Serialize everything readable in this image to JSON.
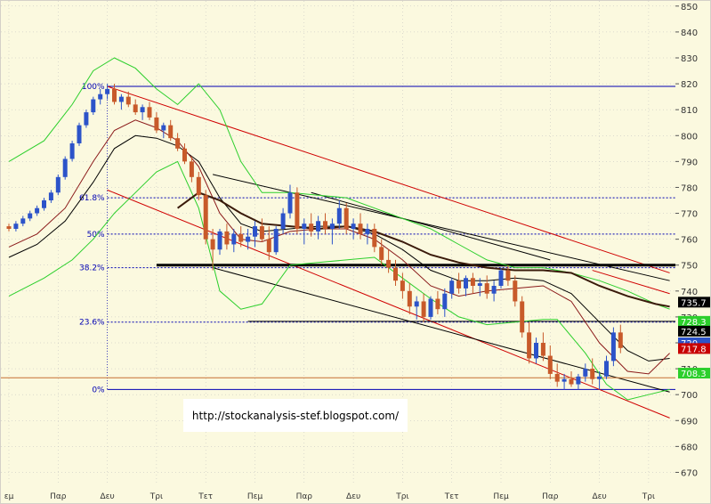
{
  "watermark": "http://stockanalysis-stef.blogspot.com/",
  "colors": {
    "background": "#fbf9df",
    "axis_bg": "#fbf9df",
    "grid": "#bdbdbd",
    "fib": "#0000b3",
    "up_candle": "#2c53c9",
    "down_candle": "#c85a2a",
    "bollinger": "#2ccf2c",
    "ma_fast": "#8b1a1a",
    "ma_slow": "#000000",
    "channel_red": "#d00000",
    "channel_black": "#000000",
    "support_orange": "#c87033"
  },
  "chart_data": {
    "type": "candlestick",
    "y_axis": {
      "min": 665,
      "max": 852,
      "ticks": [
        670,
        680,
        690,
        700,
        710,
        720,
        730,
        740,
        750,
        760,
        770,
        780,
        790,
        800,
        810,
        820,
        830,
        840,
        850
      ]
    },
    "x_ticks": [
      {
        "label": "εμ",
        "i": 0
      },
      {
        "label": "Παρ",
        "i": 7
      },
      {
        "label": "Δευ",
        "i": 14
      },
      {
        "label": "Τρι",
        "i": 21
      },
      {
        "label": "Τετ",
        "i": 28
      },
      {
        "label": "Πεμ",
        "i": 35
      },
      {
        "label": "Παρ",
        "i": 42
      },
      {
        "label": "Δευ",
        "i": 49
      },
      {
        "label": "Τρι",
        "i": 56
      },
      {
        "label": "Τετ",
        "i": 63
      },
      {
        "label": "Πεμ",
        "i": 70
      },
      {
        "label": "Παρ",
        "i": 77
      },
      {
        "label": "Δευ",
        "i": 84
      },
      {
        "label": "Τρι",
        "i": 91
      }
    ],
    "fib_levels": [
      {
        "label": "100%",
        "value": 819
      },
      {
        "label": "61.8%",
        "value": 776
      },
      {
        "label": "50%",
        "value": 762
      },
      {
        "label": "38.2%",
        "value": 749
      },
      {
        "label": "23.6%",
        "value": 728
      },
      {
        "label": "0%",
        "value": 702
      }
    ],
    "price_badges": [
      {
        "text": "735.7",
        "value": 735.7,
        "color": "#000000"
      },
      {
        "text": "728.3",
        "value": 728.3,
        "color": "#2ccf2c"
      },
      {
        "text": "724.5",
        "value": 724.5,
        "color": "#000000"
      },
      {
        "text": "720",
        "value": 720,
        "color": "#2c53c9"
      },
      {
        "text": "717.8",
        "value": 717.8,
        "color": "#c80000"
      },
      {
        "text": "708.3",
        "value": 708.3,
        "color": "#2ccf2c"
      }
    ],
    "support_line": 706.5,
    "horizontal_lines": [
      750,
      728.3
    ],
    "candles": [
      [
        765,
        766,
        763,
        764
      ],
      [
        764,
        767,
        763,
        766
      ],
      [
        766,
        769,
        765,
        768
      ],
      [
        768,
        771,
        767,
        770
      ],
      [
        770,
        773,
        769,
        772
      ],
      [
        772,
        776,
        771,
        775
      ],
      [
        775,
        779,
        774,
        778
      ],
      [
        778,
        785,
        777,
        784
      ],
      [
        784,
        792,
        783,
        791
      ],
      [
        791,
        798,
        790,
        797
      ],
      [
        797,
        805,
        796,
        804
      ],
      [
        804,
        810,
        803,
        809
      ],
      [
        809,
        815,
        808,
        814
      ],
      [
        814,
        818,
        812,
        816
      ],
      [
        816,
        820,
        814,
        818
      ],
      [
        818,
        820,
        812,
        813
      ],
      [
        813,
        816,
        810,
        815
      ],
      [
        815,
        817,
        811,
        812
      ],
      [
        812,
        814,
        808,
        809
      ],
      [
        809,
        812,
        806,
        811
      ],
      [
        811,
        813,
        806,
        807
      ],
      [
        807,
        809,
        801,
        802
      ],
      [
        802,
        805,
        799,
        804
      ],
      [
        804,
        806,
        798,
        799
      ],
      [
        799,
        801,
        794,
        795
      ],
      [
        795,
        797,
        789,
        790
      ],
      [
        790,
        792,
        782,
        784
      ],
      [
        784,
        786,
        775,
        777
      ],
      [
        777,
        779,
        758,
        760
      ],
      [
        760,
        764,
        748,
        756
      ],
      [
        756,
        764,
        754,
        763
      ],
      [
        763,
        766,
        756,
        758
      ],
      [
        758,
        764,
        755,
        762
      ],
      [
        762,
        765,
        757,
        759
      ],
      [
        759,
        764,
        756,
        761
      ],
      [
        761,
        767,
        757,
        765
      ],
      [
        765,
        768,
        759,
        760
      ],
      [
        760,
        765,
        752,
        755
      ],
      [
        755,
        765,
        754,
        764
      ],
      [
        764,
        772,
        762,
        770
      ],
      [
        770,
        781,
        768,
        778
      ],
      [
        778,
        780,
        762,
        764
      ],
      [
        764,
        768,
        758,
        766
      ],
      [
        766,
        770,
        761,
        763
      ],
      [
        763,
        769,
        760,
        767
      ],
      [
        767,
        770,
        762,
        764
      ],
      [
        764,
        768,
        758,
        766
      ],
      [
        766,
        775,
        764,
        772
      ],
      [
        772,
        774,
        762,
        764
      ],
      [
        764,
        768,
        760,
        766
      ],
      [
        766,
        770,
        760,
        762
      ],
      [
        762,
        766,
        758,
        764
      ],
      [
        764,
        766,
        755,
        757
      ],
      [
        757,
        760,
        750,
        752
      ],
      [
        752,
        756,
        747,
        749
      ],
      [
        749,
        752,
        742,
        744
      ],
      [
        744,
        747,
        737,
        740
      ],
      [
        740,
        743,
        731,
        734
      ],
      [
        734,
        738,
        729,
        736
      ],
      [
        736,
        739,
        728,
        730
      ],
      [
        730,
        738,
        729,
        737
      ],
      [
        737,
        740,
        731,
        733
      ],
      [
        733,
        741,
        730,
        739
      ],
      [
        739,
        745,
        737,
        744
      ],
      [
        744,
        747,
        739,
        741
      ],
      [
        741,
        746,
        738,
        745
      ],
      [
        745,
        747,
        739,
        742
      ],
      [
        742,
        745,
        738,
        743
      ],
      [
        743,
        746,
        737,
        739
      ],
      [
        739,
        744,
        736,
        742
      ],
      [
        742,
        749,
        741,
        748
      ],
      [
        748,
        750,
        742,
        744
      ],
      [
        744,
        746,
        734,
        736
      ],
      [
        736,
        738,
        722,
        724
      ],
      [
        724,
        728,
        712,
        714
      ],
      [
        714,
        722,
        712,
        720
      ],
      [
        720,
        724,
        713,
        715
      ],
      [
        715,
        719,
        706,
        708
      ],
      [
        708,
        712,
        703,
        705
      ],
      [
        705,
        708,
        702,
        706
      ],
      [
        706,
        709,
        703,
        704
      ],
      [
        704,
        708,
        702,
        707
      ],
      [
        707,
        712,
        705,
        710
      ],
      [
        710,
        714,
        704,
        706
      ],
      [
        706,
        709,
        702,
        707
      ],
      [
        707,
        715,
        706,
        713
      ],
      [
        713,
        726,
        711,
        724
      ],
      [
        724,
        727,
        716,
        718
      ]
    ],
    "boll_upper": [
      [
        0,
        790
      ],
      [
        5,
        798
      ],
      [
        9,
        812
      ],
      [
        12,
        825
      ],
      [
        15,
        830
      ],
      [
        18,
        826
      ],
      [
        21,
        818
      ],
      [
        24,
        812
      ],
      [
        27,
        820
      ],
      [
        30,
        810
      ],
      [
        33,
        790
      ],
      [
        36,
        778
      ],
      [
        40,
        778
      ],
      [
        44,
        777
      ],
      [
        48,
        776
      ],
      [
        52,
        772
      ],
      [
        56,
        768
      ],
      [
        60,
        764
      ],
      [
        64,
        758
      ],
      [
        68,
        752
      ],
      [
        72,
        749
      ],
      [
        76,
        749
      ],
      [
        80,
        747
      ],
      [
        84,
        744
      ],
      [
        88,
        740
      ],
      [
        92,
        735
      ],
      [
        94,
        733
      ]
    ],
    "boll_lower": [
      [
        0,
        738
      ],
      [
        5,
        745
      ],
      [
        9,
        752
      ],
      [
        12,
        760
      ],
      [
        15,
        770
      ],
      [
        18,
        778
      ],
      [
        21,
        786
      ],
      [
        24,
        790
      ],
      [
        27,
        772
      ],
      [
        30,
        740
      ],
      [
        33,
        733
      ],
      [
        36,
        735
      ],
      [
        40,
        750
      ],
      [
        44,
        751
      ],
      [
        48,
        752
      ],
      [
        52,
        753
      ],
      [
        56,
        745
      ],
      [
        60,
        737
      ],
      [
        64,
        730
      ],
      [
        68,
        727
      ],
      [
        72,
        728
      ],
      [
        76,
        729
      ],
      [
        78,
        729
      ],
      [
        82,
        716
      ],
      [
        85,
        704
      ],
      [
        88,
        698
      ],
      [
        91,
        700
      ],
      [
        94,
        702
      ]
    ],
    "ma_fast": [
      [
        0,
        757
      ],
      [
        4,
        762
      ],
      [
        8,
        772
      ],
      [
        12,
        790
      ],
      [
        15,
        802
      ],
      [
        18,
        806
      ],
      [
        21,
        803
      ],
      [
        24,
        798
      ],
      [
        27,
        788
      ],
      [
        30,
        770
      ],
      [
        33,
        760
      ],
      [
        36,
        759
      ],
      [
        40,
        763
      ],
      [
        44,
        764
      ],
      [
        48,
        764
      ],
      [
        52,
        760
      ],
      [
        56,
        752
      ],
      [
        60,
        742
      ],
      [
        64,
        738
      ],
      [
        68,
        740
      ],
      [
        72,
        741
      ],
      [
        76,
        742
      ],
      [
        80,
        736
      ],
      [
        84,
        720
      ],
      [
        88,
        709
      ],
      [
        91,
        708
      ],
      [
        94,
        716
      ]
    ],
    "ma_mid": [
      [
        0,
        753
      ],
      [
        4,
        758
      ],
      [
        8,
        767
      ],
      [
        12,
        782
      ],
      [
        15,
        795
      ],
      [
        18,
        800
      ],
      [
        21,
        799
      ],
      [
        24,
        796
      ],
      [
        27,
        790
      ],
      [
        30,
        776
      ],
      [
        33,
        766
      ],
      [
        36,
        763
      ],
      [
        40,
        764
      ],
      [
        44,
        765
      ],
      [
        48,
        765
      ],
      [
        52,
        762
      ],
      [
        56,
        756
      ],
      [
        60,
        748
      ],
      [
        64,
        744
      ],
      [
        68,
        744
      ],
      [
        72,
        745
      ],
      [
        76,
        744
      ],
      [
        80,
        739
      ],
      [
        84,
        728
      ],
      [
        88,
        717
      ],
      [
        91,
        713
      ],
      [
        94,
        714
      ]
    ],
    "ma_long": [
      [
        24,
        772
      ],
      [
        27,
        778
      ],
      [
        30,
        775
      ],
      [
        33,
        770
      ],
      [
        36,
        766
      ],
      [
        40,
        765
      ],
      [
        44,
        764
      ],
      [
        48,
        765
      ],
      [
        52,
        763
      ],
      [
        56,
        759
      ],
      [
        60,
        754
      ],
      [
        64,
        751
      ],
      [
        68,
        749
      ],
      [
        72,
        748
      ],
      [
        76,
        748
      ],
      [
        80,
        747
      ],
      [
        84,
        742
      ],
      [
        88,
        738
      ],
      [
        92,
        735
      ],
      [
        94,
        734
      ]
    ],
    "channels": [
      {
        "color": "#d00000",
        "from": [
          14,
          819
        ],
        "to": [
          94,
          747
        ]
      },
      {
        "color": "#d00000",
        "from": [
          14,
          779
        ],
        "to": [
          94,
          691
        ]
      },
      {
        "color": "#000000",
        "from": [
          29,
          785
        ],
        "to": [
          94,
          744
        ]
      },
      {
        "color": "#000000",
        "from": [
          29,
          749
        ],
        "to": [
          94,
          701
        ]
      },
      {
        "color": "#000000",
        "from": [
          43,
          778
        ],
        "to": [
          77,
          752
        ]
      },
      {
        "color": "#d00000",
        "from": [
          83,
          748
        ],
        "to": [
          94,
          739
        ]
      }
    ]
  }
}
